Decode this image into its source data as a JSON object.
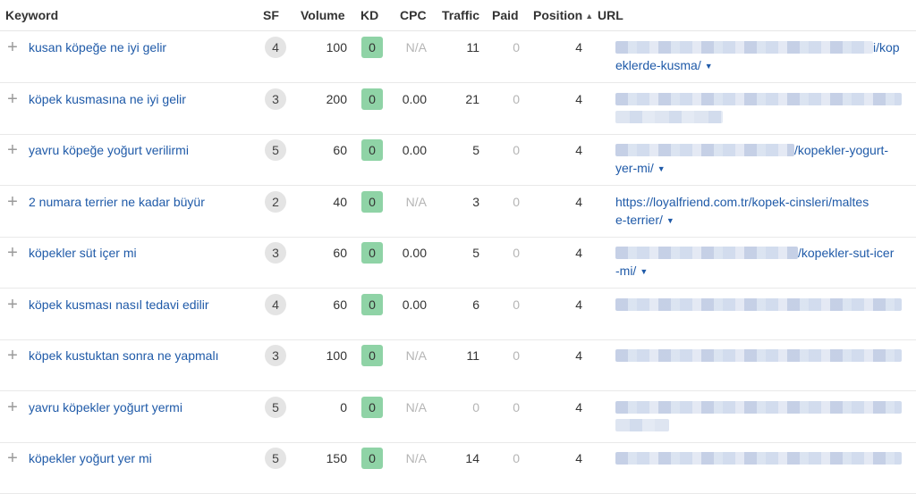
{
  "headers": {
    "keyword": "Keyword",
    "sf": "SF",
    "volume": "Volume",
    "kd": "KD",
    "cpc": "CPC",
    "traffic": "Traffic",
    "paid": "Paid",
    "position": "Position",
    "url": "URL"
  },
  "icons": {
    "expand": "plus-icon",
    "sort": "sort-up-icon",
    "url_menu": "caret-down-icon"
  },
  "rows": [
    {
      "keyword": "kusan köpeğe ne iyi gelir",
      "sf": "4",
      "volume": "100",
      "kd": "0",
      "cpc": "N/A",
      "traffic": "11",
      "paid": "0",
      "position": "4",
      "url_l1": "i/kop",
      "url_l2": "eklerde-kusma/",
      "l1_blur": true,
      "l2_blur": false,
      "caret": true
    },
    {
      "keyword": "köpek kusmasına ne iyi gelir",
      "sf": "3",
      "volume": "200",
      "kd": "0",
      "cpc": "0.00",
      "traffic": "21",
      "paid": "0",
      "position": "4",
      "url_l1": "",
      "url_l2": "",
      "l1_blur": true,
      "l2_blur": true,
      "caret": false
    },
    {
      "keyword": "yavru köpeğe yoğurt verilirmi",
      "sf": "5",
      "volume": "60",
      "kd": "0",
      "cpc": "0.00",
      "traffic": "5",
      "paid": "0",
      "position": "4",
      "url_l1": "/kopekler-yogurt-",
      "url_l2": "yer-mi/",
      "l1_blur": true,
      "l2_blur": false,
      "caret": true
    },
    {
      "keyword": "2 numara terrier ne kadar büyür",
      "sf": "2",
      "volume": "40",
      "kd": "0",
      "cpc": "N/A",
      "traffic": "3",
      "paid": "0",
      "position": "4",
      "url_l1": "https://loyalfriend.com.tr/kopek-cinsleri/maltes",
      "url_l2": "e-terrier/",
      "l1_blur": false,
      "l2_blur": false,
      "caret": true
    },
    {
      "keyword": "köpekler süt içer mi",
      "sf": "3",
      "volume": "60",
      "kd": "0",
      "cpc": "0.00",
      "traffic": "5",
      "paid": "0",
      "position": "4",
      "url_l1": "/kopekler-sut-icer",
      "url_l2": "-mi/",
      "l1_blur": true,
      "l2_blur": false,
      "caret": true
    },
    {
      "keyword": "köpek kusması nasıl tedavi edilir",
      "sf": "4",
      "volume": "60",
      "kd": "0",
      "cpc": "0.00",
      "traffic": "6",
      "paid": "0",
      "position": "4",
      "url_l1": "",
      "url_l2": "",
      "l1_blur": true,
      "l2_blur": true,
      "caret": false
    },
    {
      "keyword": "köpek kustuktan sonra ne yapmalı",
      "sf": "3",
      "volume": "100",
      "kd": "0",
      "cpc": "N/A",
      "traffic": "11",
      "paid": "0",
      "position": "4",
      "url_l1": "",
      "url_l2": "",
      "l1_blur": true,
      "l2_blur": true,
      "caret": false
    },
    {
      "keyword": "yavru köpekler yoğurt yermi",
      "sf": "5",
      "volume": "0",
      "kd": "0",
      "cpc": "N/A",
      "traffic": "0",
      "paid": "0",
      "position": "4",
      "url_l1": "",
      "url_l2": "",
      "l1_blur": true,
      "l2_blur": true,
      "caret": false
    },
    {
      "keyword": "köpekler yoğurt yer mi",
      "sf": "5",
      "volume": "150",
      "kd": "0",
      "cpc": "N/A",
      "traffic": "14",
      "paid": "0",
      "position": "4",
      "url_l1": "",
      "url_l2": "",
      "l1_blur": true,
      "l2_blur": true,
      "caret": false
    }
  ],
  "colors": {
    "link": "#1f5aa8",
    "kd_easy": "#8fd3a6",
    "sf_badge": "#e4e4e4",
    "muted": "#b5b5b5"
  }
}
